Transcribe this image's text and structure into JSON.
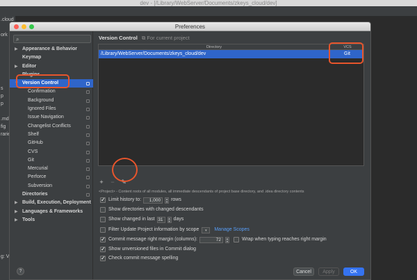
{
  "background": {
    "window_title": "dev - [/Library/WebServer/Documents/zkeys_cloud/dev]",
    "left_panel_fragments": [
      ".cloud",
      "",
      "ork",
      "",
      "",
      "",
      "",
      "",
      "",
      "s",
      "p",
      "p",
      "",
      ".md",
      "fig",
      "raries",
      "",
      "",
      "",
      "",
      "",
      "",
      "",
      "",
      "",
      "",
      "",
      "",
      "",
      "",
      "",
      "g: Ve"
    ]
  },
  "dialog": {
    "title": "Preferences"
  },
  "sidebar": {
    "search_placeholder": "",
    "items": [
      {
        "label": "Appearance & Behavior",
        "level": 0,
        "bold": true,
        "arrow": "▶",
        "selected": false,
        "project_icon": false
      },
      {
        "label": "Keymap",
        "level": 0,
        "bold": true,
        "arrow": "",
        "selected": false,
        "project_icon": false
      },
      {
        "label": "Editor",
        "level": 0,
        "bold": true,
        "arrow": "▶",
        "selected": false,
        "project_icon": false
      },
      {
        "label": "Plugins",
        "level": 0,
        "bold": true,
        "arrow": "",
        "selected": false,
        "project_icon": false
      },
      {
        "label": "Version Control",
        "level": 0,
        "bold": true,
        "arrow": "▼",
        "selected": true,
        "project_icon": true
      },
      {
        "label": "Confirmation",
        "level": 1,
        "bold": false,
        "arrow": "",
        "selected": false,
        "project_icon": true
      },
      {
        "label": "Background",
        "level": 1,
        "bold": false,
        "arrow": "",
        "selected": false,
        "project_icon": true
      },
      {
        "label": "Ignored Files",
        "level": 1,
        "bold": false,
        "arrow": "",
        "selected": false,
        "project_icon": true
      },
      {
        "label": "Issue Navigation",
        "level": 1,
        "bold": false,
        "arrow": "",
        "selected": false,
        "project_icon": true
      },
      {
        "label": "Changelist Conflicts",
        "level": 1,
        "bold": false,
        "arrow": "",
        "selected": false,
        "project_icon": true
      },
      {
        "label": "Shelf",
        "level": 1,
        "bold": false,
        "arrow": "",
        "selected": false,
        "project_icon": true
      },
      {
        "label": "GitHub",
        "level": 1,
        "bold": false,
        "arrow": "",
        "selected": false,
        "project_icon": true
      },
      {
        "label": "CVS",
        "level": 1,
        "bold": false,
        "arrow": "",
        "selected": false,
        "project_icon": true
      },
      {
        "label": "Git",
        "level": 1,
        "bold": false,
        "arrow": "",
        "selected": false,
        "project_icon": true
      },
      {
        "label": "Mercurial",
        "level": 1,
        "bold": false,
        "arrow": "",
        "selected": false,
        "project_icon": true
      },
      {
        "label": "Perforce",
        "level": 1,
        "bold": false,
        "arrow": "",
        "selected": false,
        "project_icon": true
      },
      {
        "label": "Subversion",
        "level": 1,
        "bold": false,
        "arrow": "",
        "selected": false,
        "project_icon": true
      },
      {
        "label": "Directories",
        "level": 0,
        "bold": true,
        "arrow": "",
        "selected": false,
        "project_icon": true
      },
      {
        "label": "Build, Execution, Deployment",
        "level": 0,
        "bold": true,
        "arrow": "▶",
        "selected": false,
        "project_icon": false
      },
      {
        "label": "Languages & Frameworks",
        "level": 0,
        "bold": true,
        "arrow": "▶",
        "selected": false,
        "project_icon": false
      },
      {
        "label": "Tools",
        "level": 0,
        "bold": true,
        "arrow": "▶",
        "selected": false,
        "project_icon": false
      }
    ]
  },
  "content": {
    "title": "Version Control",
    "scope_note": "For current project",
    "table": {
      "col_directory": "Directory",
      "col_vcs": "VCS",
      "rows": [
        {
          "directory": "/Library/WebServer/Documents/zkeys_cloud/dev",
          "vcs": "Git"
        }
      ]
    },
    "toolbar": {
      "add": "+",
      "remove": "−",
      "edit": "✎"
    },
    "hint": "<Project> - Content roots of all modules, all immediate descendants of project base directory, and .idea directory contents",
    "options": {
      "limit_history": {
        "label": "Limit history to:",
        "value": "1,000",
        "suffix": "rows",
        "checked": true
      },
      "show_dirs": {
        "label": "Show directories with changed descendants",
        "checked": false
      },
      "show_changed": {
        "label": "Show changed in last",
        "value": "31",
        "suffix": "days",
        "checked": false
      },
      "filter_update": {
        "label": "Filter Update Project information by scope",
        "link": "Manage Scopes",
        "checked": false
      },
      "commit_margin": {
        "label": "Commit message right margin (columns):",
        "value": "72",
        "checked": true
      },
      "wrap_typing": {
        "label": "Wrap when typing reaches right margin",
        "checked": false
      },
      "show_unversioned": {
        "label": "Show unversioned files in Commit dialog",
        "checked": true
      },
      "check_spelling": {
        "label": "Check commit message spelling",
        "checked": true
      }
    }
  },
  "footer": {
    "help": "?",
    "cancel": "Cancel",
    "apply": "Apply",
    "ok": "OK"
  },
  "annotation_color": "#e8552c"
}
